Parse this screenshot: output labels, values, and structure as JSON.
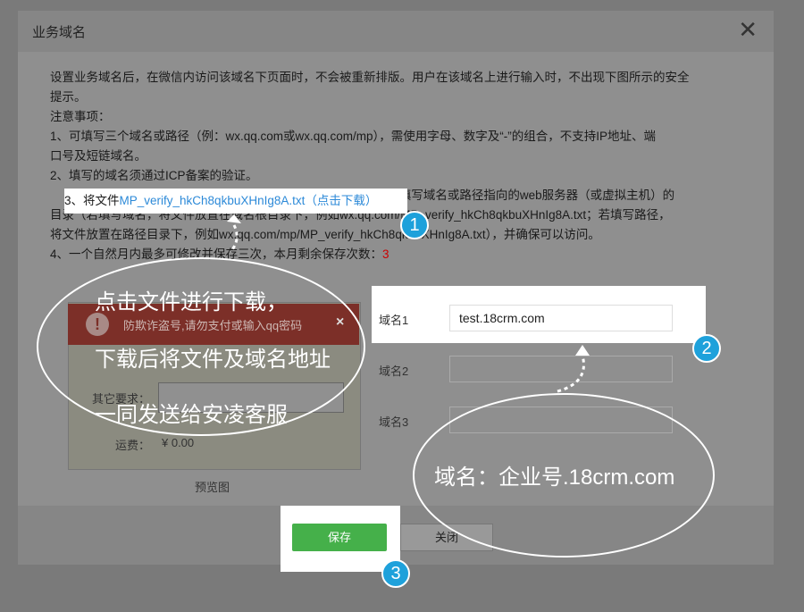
{
  "dialog": {
    "title": "业务域名",
    "close_icon": "close-icon"
  },
  "instructions": {
    "intro_line1": "设置业务域名后，在微信内访问该域名下页面时，不会被重新排版。用户在该域名上进行输入时，不出现下图所示的安全",
    "intro_line2": "提示。",
    "notice_title": "注意事项：",
    "item1_line1": "1、可填写三个域名或路径（例：wx.qq.com或wx.qq.com/mp），需使用字母、数字及“-”的组合，不支持IP地址、端",
    "item1_line2": "口号及短链域名。",
    "item2": "2、填写的域名须通过ICP备案的验证。",
    "item3_prefix": "3、将文件",
    "item3_link": "MP_verify_hkCh8qkbuXHnIg8A.txt（点击下载）",
    "item3_rest": "上传至填写域名或路径指向的web服务器（或虚拟主机）的",
    "item3_line2": "目录（若填写域名，将文件放置在域名根目录下，例如wx.qq.com/MP_verify_hkCh8qkbuXHnIg8A.txt；若填写路径，",
    "item3_line3": "将文件放置在路径目录下，例如wx.qq.com/mp/MP_verify_hkCh8qkbuXHnIg8A.txt），并确保可以访问。",
    "item4_prefix": "4、一个自然月内最多可修改并保存三次，本月剩余保存次数：",
    "item4_count": "3"
  },
  "preview": {
    "warning_text": "防欺诈盗号,请勿支付或输入qq密码",
    "warning_close": "×",
    "other_label": "其它要求：",
    "fee_label": "运费：",
    "fee_value": "¥ 0.00",
    "caption": "预览图"
  },
  "domains": {
    "label1": "域名1",
    "value1": "test.18crm.com",
    "label2": "域名2",
    "value2": "",
    "label3": "域名3",
    "value3": ""
  },
  "buttons": {
    "save": "保存",
    "close": "关闭"
  },
  "annotations": {
    "badge1": "1",
    "badge2": "2",
    "badge3": "3",
    "callout1_line1": "点击文件进行下载，",
    "callout1_line2": "下载后将文件及域名地址",
    "callout1_line3": "一同发送给安凌客服",
    "callout2": "域名：企业号.18crm.com"
  },
  "colors": {
    "save_green": "#45b04a",
    "link_blue": "#2d8ad8",
    "badge_blue": "#1ea1db",
    "warning_red": "#7c2f28"
  }
}
